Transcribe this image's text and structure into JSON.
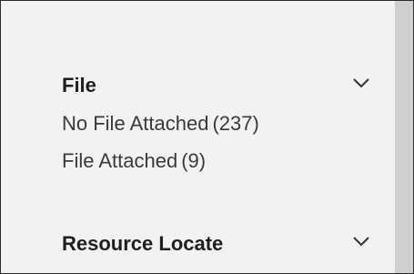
{
  "sections": [
    {
      "title": "File",
      "options": [
        {
          "label": "No File Attached",
          "count": "(237)"
        },
        {
          "label": "File Attached",
          "count": "(9)"
        }
      ],
      "icon": "chevron-down-icon"
    },
    {
      "title": "Resource Locate",
      "icon": "chevron-down-icon"
    }
  ],
  "colors": {
    "panel_bg": "#f2f2f2",
    "scrollbar": "#cfcfcf",
    "title_text": "#1f1f1f",
    "option_text": "#3a3a3a"
  }
}
